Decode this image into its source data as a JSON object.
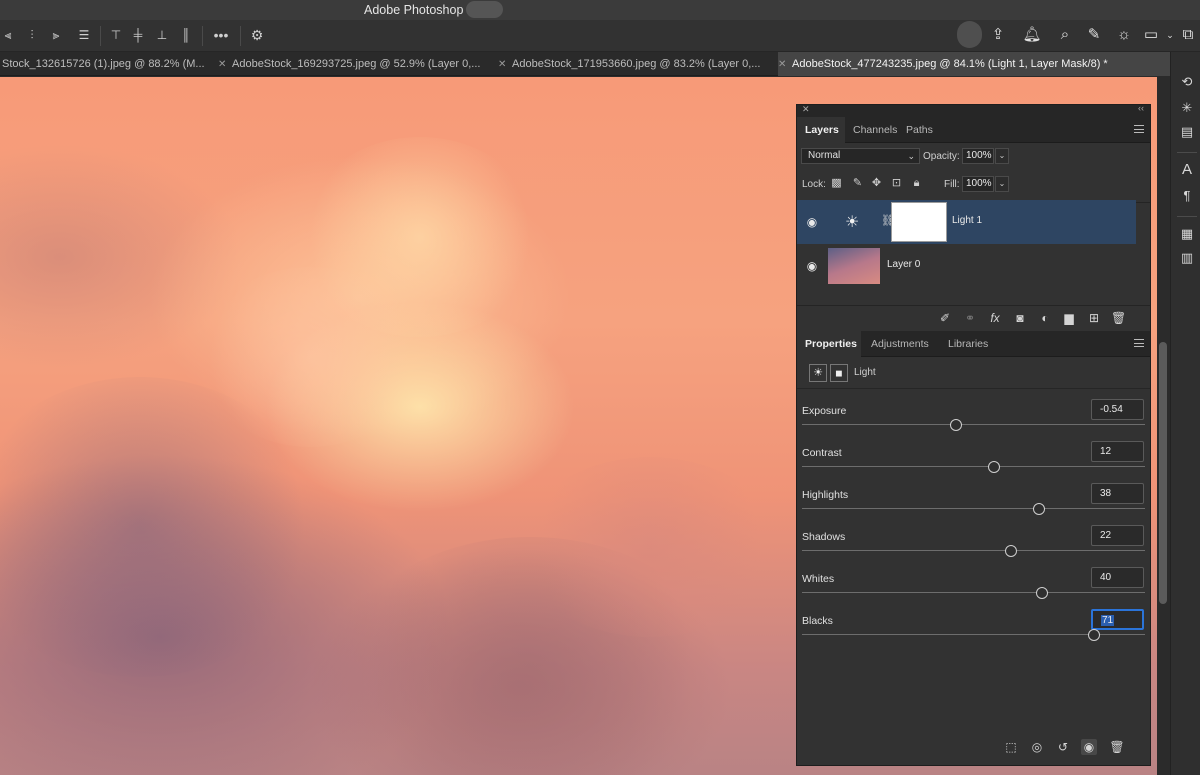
{
  "app": {
    "title": "Adobe Photoshop"
  },
  "tabs": [
    {
      "label": "Stock_132615726 (1).jpeg @ 88.2% (M..."
    },
    {
      "label": "AdobeStock_169293725.jpeg @ 52.9% (Layer 0,..."
    },
    {
      "label": "AdobeStock_171953660.jpeg @ 83.2% (Layer 0,..."
    },
    {
      "label": "AdobeStock_477243235.jpeg @ 84.1% (Light 1, Layer Mask/8) *"
    }
  ],
  "layers_panel": {
    "tabs": [
      "Layers",
      "Channels",
      "Paths"
    ],
    "blend_mode": "Normal",
    "opacity_label": "Opacity:",
    "opacity_value": "100%",
    "lock_label": "Lock:",
    "fill_label": "Fill:",
    "fill_value": "100%",
    "layers": [
      {
        "name": "Light 1",
        "selected": true
      },
      {
        "name": "Layer 0",
        "selected": false
      }
    ]
  },
  "properties_panel": {
    "tabs": [
      "Properties",
      "Adjustments",
      "Libraries"
    ],
    "adjustment_name": "Light",
    "sliders": [
      {
        "label": "Exposure",
        "value": "-0.54",
        "fraction": 0.45
      },
      {
        "label": "Contrast",
        "value": "12",
        "fraction": 0.56
      },
      {
        "label": "Highlights",
        "value": "38",
        "fraction": 0.69
      },
      {
        "label": "Shadows",
        "value": "22",
        "fraction": 0.61
      },
      {
        "label": "Whites",
        "value": "40",
        "fraction": 0.7
      },
      {
        "label": "Blacks",
        "value": "71",
        "fraction": 0.85
      }
    ]
  },
  "colors": {
    "selection": "#2e4562",
    "focus": "#2b74d9"
  }
}
